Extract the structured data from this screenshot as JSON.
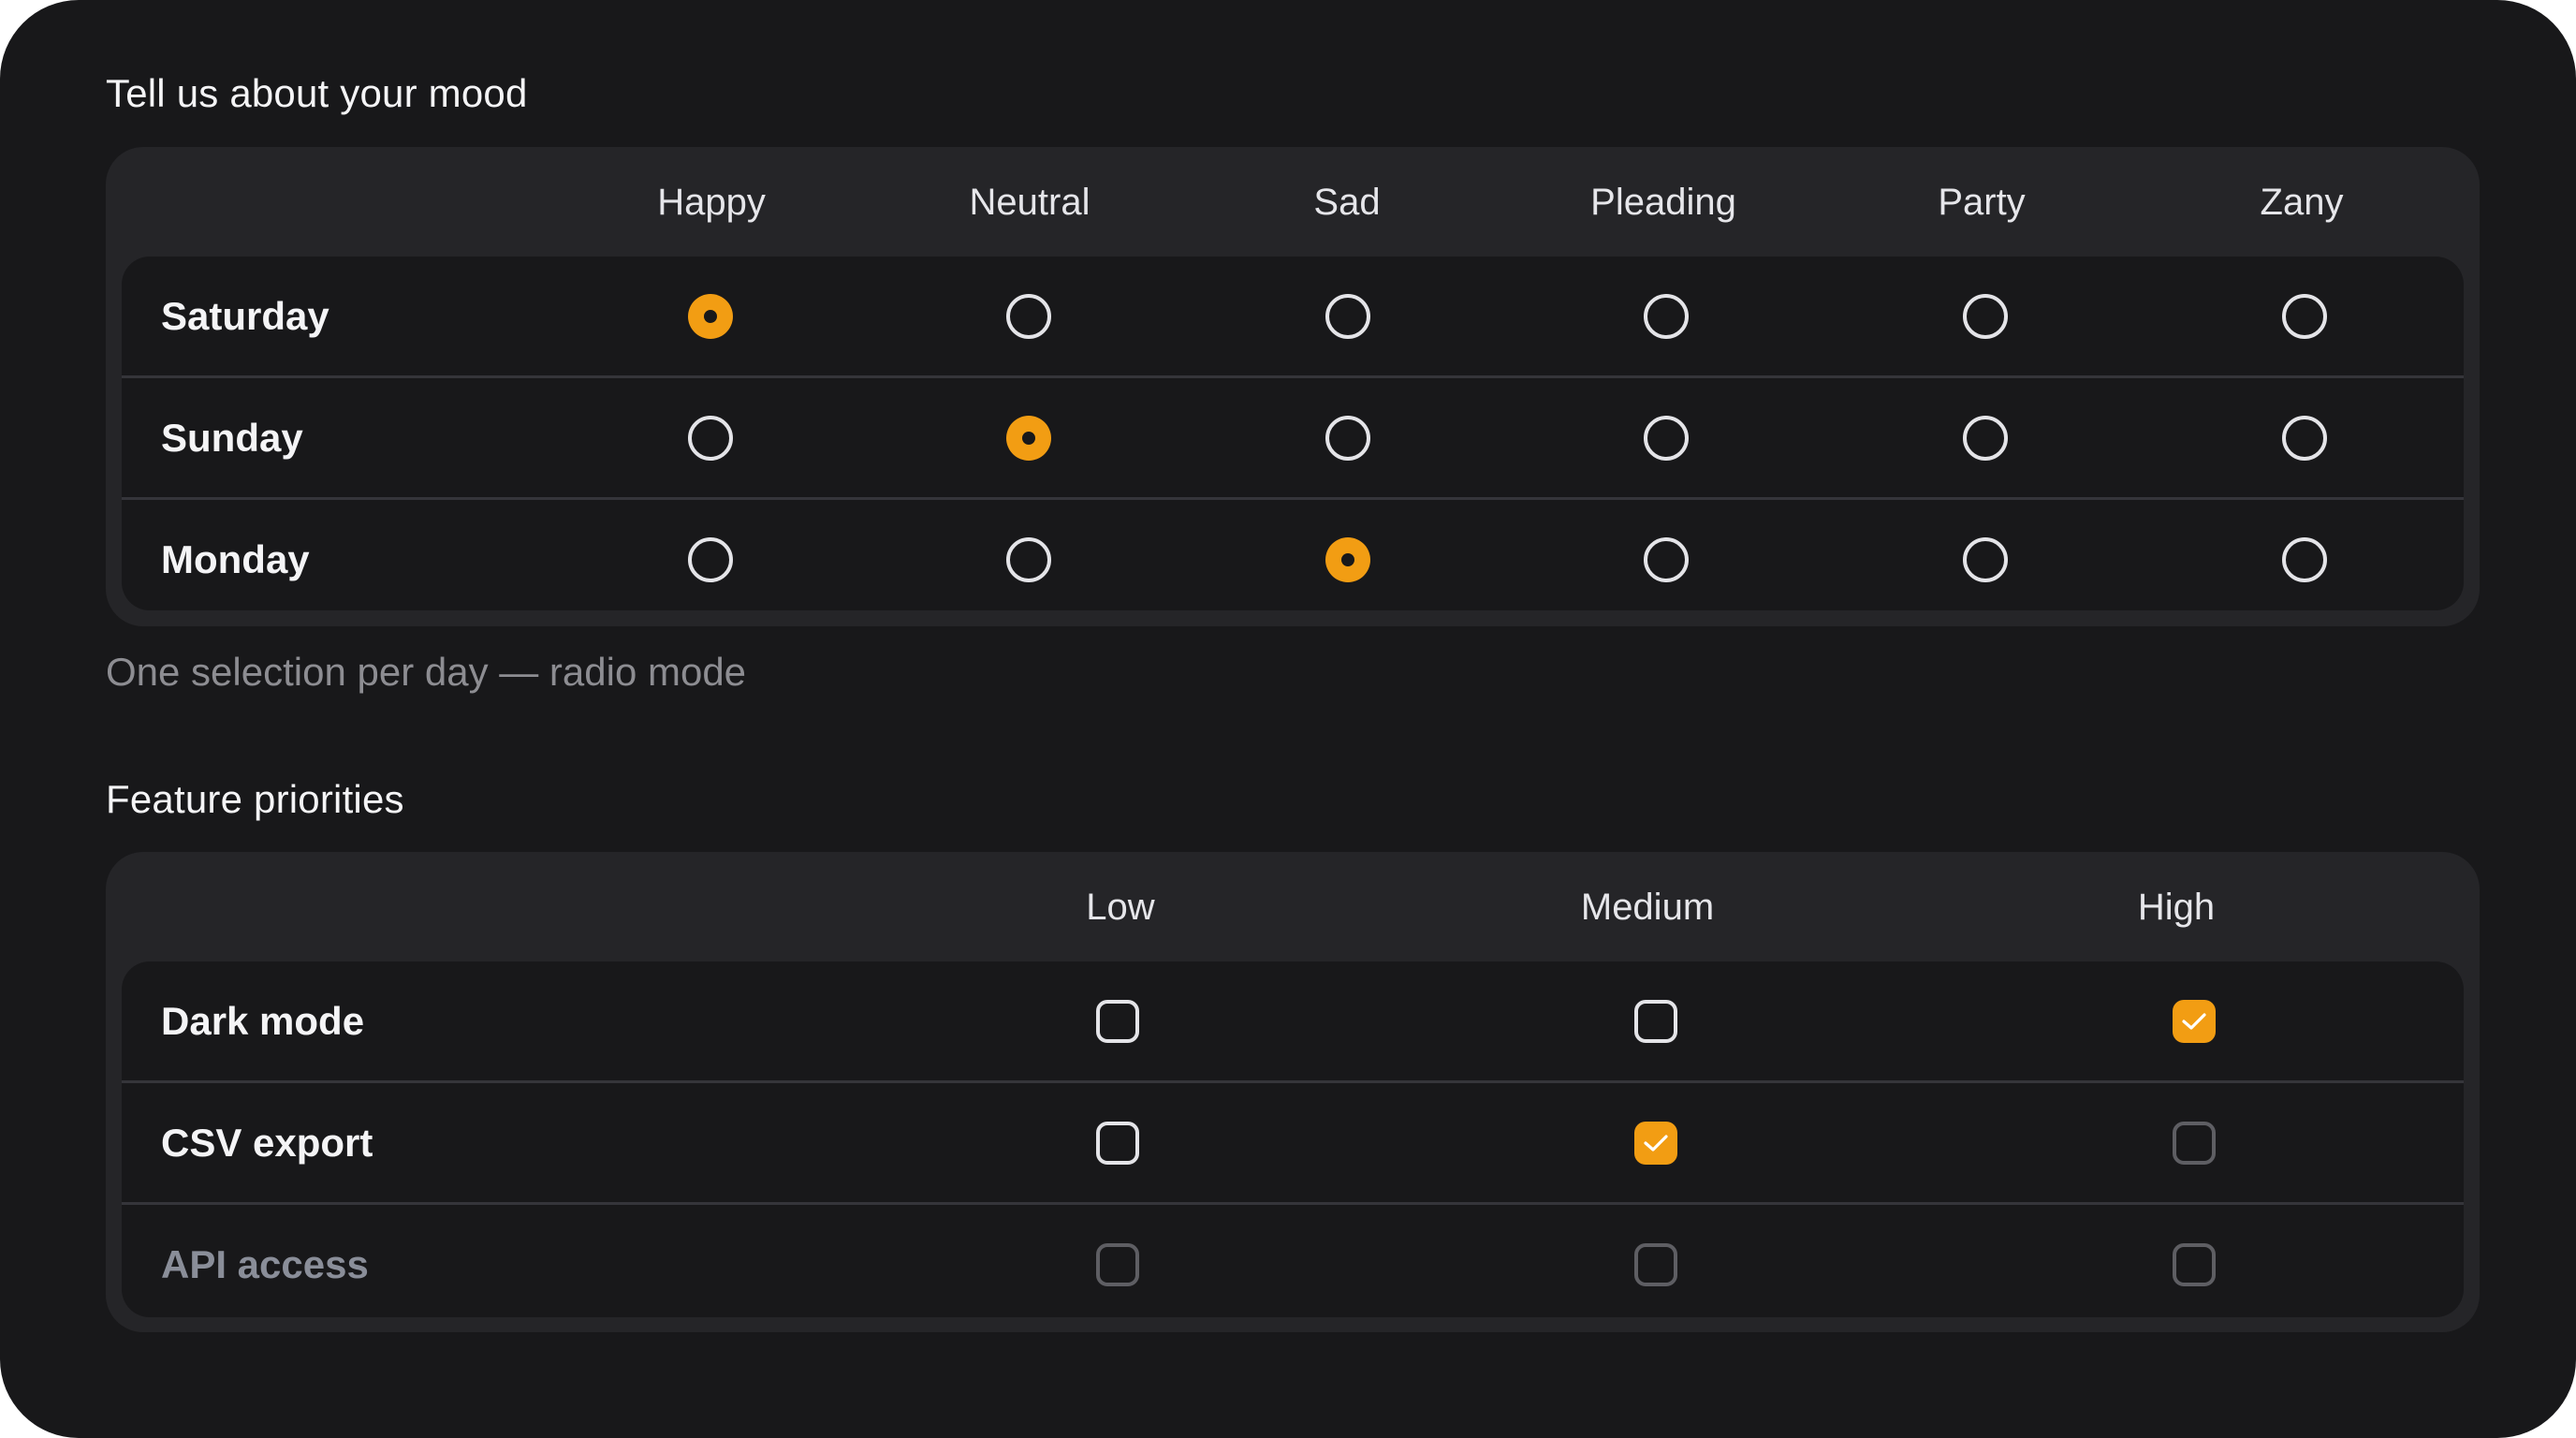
{
  "mood": {
    "title": "Tell us about your mood",
    "columns": [
      "Happy",
      "Neutral",
      "Sad",
      "Pleading",
      "Party",
      "Zany"
    ],
    "rows": [
      {
        "label": "Saturday",
        "selected": 0
      },
      {
        "label": "Sunday",
        "selected": 1
      },
      {
        "label": "Monday",
        "selected": 2
      }
    ],
    "caption": "One selection per day — radio mode"
  },
  "features": {
    "title": "Feature priorities",
    "columns": [
      "Low",
      "Medium",
      "High"
    ],
    "rows": [
      {
        "label": "Dark mode",
        "checked": [
          false,
          false,
          true
        ],
        "disabled": [
          false,
          false,
          false
        ],
        "row_disabled": false
      },
      {
        "label": "CSV export",
        "checked": [
          false,
          true,
          false
        ],
        "disabled": [
          false,
          false,
          true
        ],
        "row_disabled": false
      },
      {
        "label": "API access",
        "checked": [
          false,
          false,
          false
        ],
        "disabled": [
          true,
          true,
          true
        ],
        "row_disabled": true
      }
    ]
  },
  "colors": {
    "background": "#18181a",
    "panel": "#252528",
    "accent": "#f29d13",
    "text": "#f4f4f6",
    "muted": "#8d8d92"
  },
  "icons": {
    "radio_selected": "radio-selected-icon",
    "radio_unselected": "radio-unselected-icon",
    "checkbox_checked": "checkmark-icon",
    "checkbox_unchecked": "checkbox-empty-icon"
  }
}
